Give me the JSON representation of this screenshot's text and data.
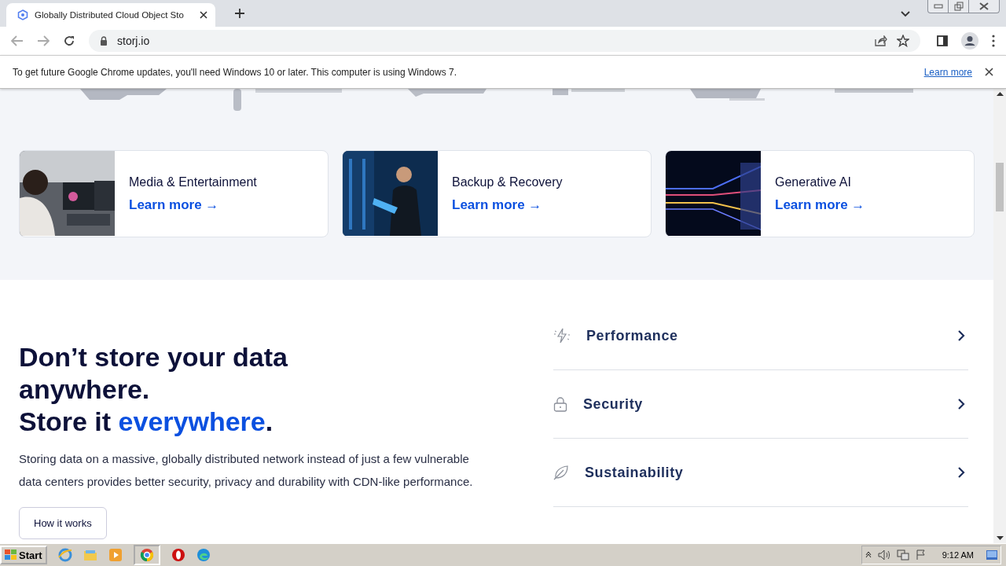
{
  "browser": {
    "tab_title": "Globally Distributed Cloud Object Sto",
    "address": "storj.io",
    "infobar": {
      "message": "To get future Google Chrome updates, you'll need Windows 10 or later. This computer is using Windows 7.",
      "link": "Learn more"
    }
  },
  "use_cases": [
    {
      "title": "Media & Entertainment",
      "link": "Learn more →",
      "kind": "media"
    },
    {
      "title": "Backup & Recovery",
      "link": "Learn more →",
      "kind": "backup"
    },
    {
      "title": "Generative AI",
      "link": "Learn more →",
      "kind": "ai"
    }
  ],
  "hero": {
    "heading": "Don’t store your data anywhere.",
    "heading_2": "Store it *everywhere*.",
    "description": "Storing data on a massive, globally distributed network instead of just a few vulnerable data centers provides better security, privacy and durability with CDN-like performance.",
    "button": "How it works"
  },
  "features": [
    {
      "label": "Performance",
      "kind": "bolt"
    },
    {
      "label": "Security",
      "kind": "lock"
    },
    {
      "label": "Sustainability",
      "kind": "leaf"
    }
  ],
  "taskbar": {
    "start": "Start",
    "time": "9:12 AM"
  }
}
